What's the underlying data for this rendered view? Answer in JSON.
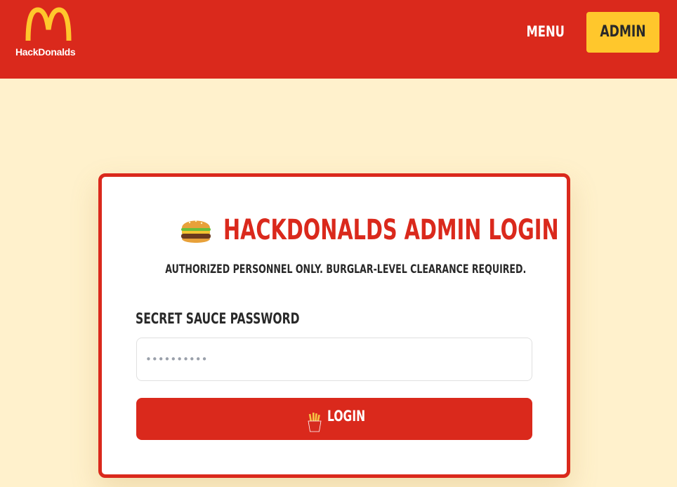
{
  "header": {
    "brand": "HackDonalds",
    "nav_menu": "MENU",
    "nav_admin": "ADMIN"
  },
  "login": {
    "title": "HACKDONALDS ADMIN LOGIN",
    "title_icon": "hamburger-icon",
    "subtitle": "AUTHORIZED PERSONNEL ONLY. BURGLAR-LEVEL CLEARANCE REQUIRED.",
    "password_label": "SECRET SAUCE PASSWORD",
    "password_placeholder": "••••••••••",
    "button_label": "LOGIN",
    "button_icon": "fries-icon"
  },
  "colors": {
    "brand_red": "#da291c",
    "brand_yellow": "#ffc72c",
    "page_bg": "#fff1cc",
    "text_dark": "#292929"
  }
}
